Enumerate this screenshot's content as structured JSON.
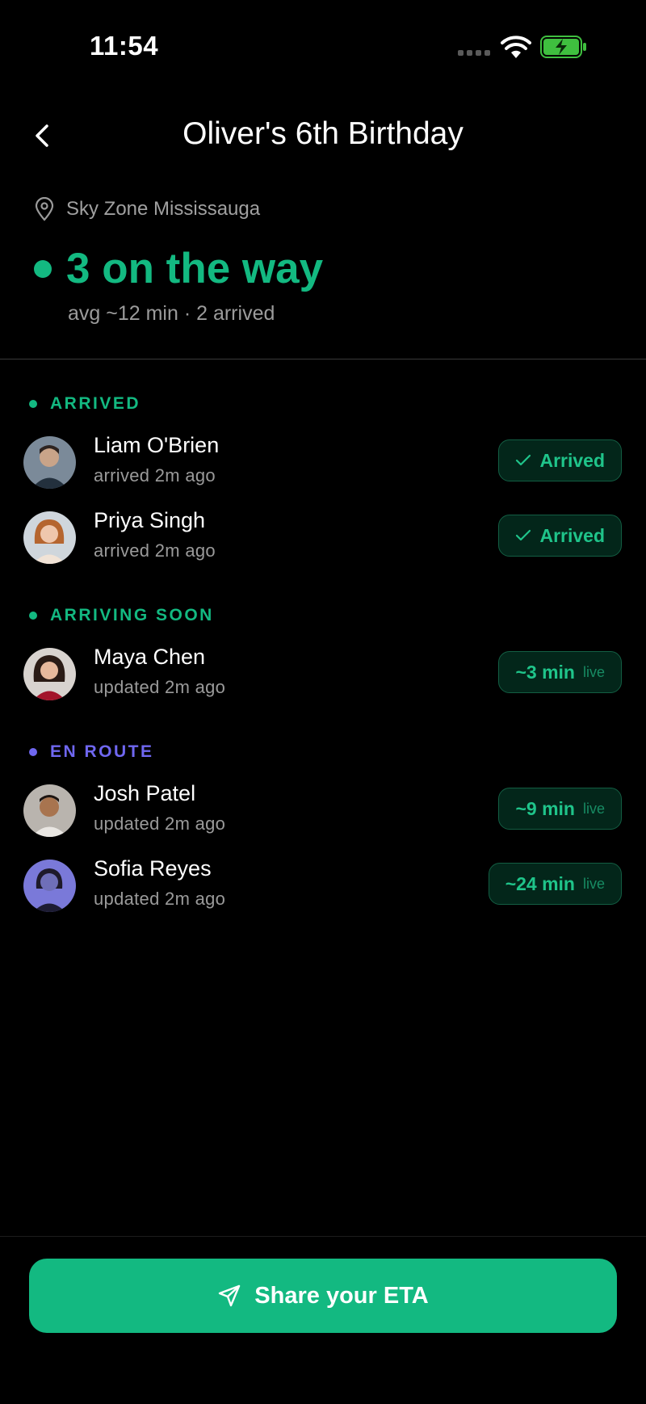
{
  "status_bar": {
    "time": "11:54"
  },
  "header": {
    "title": "Oliver's 6th Birthday"
  },
  "summary": {
    "location": "Sky Zone Mississauga",
    "headline": "3 on the way",
    "subline": "avg ~12 min · 2 arrived"
  },
  "sections": {
    "arrived": {
      "label": "ARRIVED",
      "color": "#13b981",
      "people": [
        {
          "name": "Liam O'Brien",
          "meta": "arrived 2m ago",
          "status": "Arrived"
        },
        {
          "name": "Priya Singh",
          "meta": "arrived 2m ago",
          "status": "Arrived"
        }
      ]
    },
    "arriving_soon": {
      "label": "ARRIVING SOON",
      "color": "#13b981",
      "people": [
        {
          "name": "Maya Chen",
          "meta": "updated 2m ago",
          "eta": "~3 min",
          "live": "live"
        }
      ]
    },
    "en_route": {
      "label": "EN ROUTE",
      "color": "#6f67f0",
      "people": [
        {
          "name": "Josh Patel",
          "meta": "updated 2m ago",
          "eta": "~9 min",
          "live": "live"
        },
        {
          "name": "Sofia Reyes",
          "meta": "updated 2m ago",
          "eta": "~24 min",
          "live": "live"
        }
      ]
    }
  },
  "cta": {
    "label": "Share your ETA",
    "color": "#13b981"
  },
  "icons": {
    "back": "chevron-left-icon",
    "location": "map-pin-icon",
    "check": "check-icon",
    "send": "paper-plane-icon",
    "wifi": "wifi-icon",
    "battery": "battery-charging-icon"
  }
}
